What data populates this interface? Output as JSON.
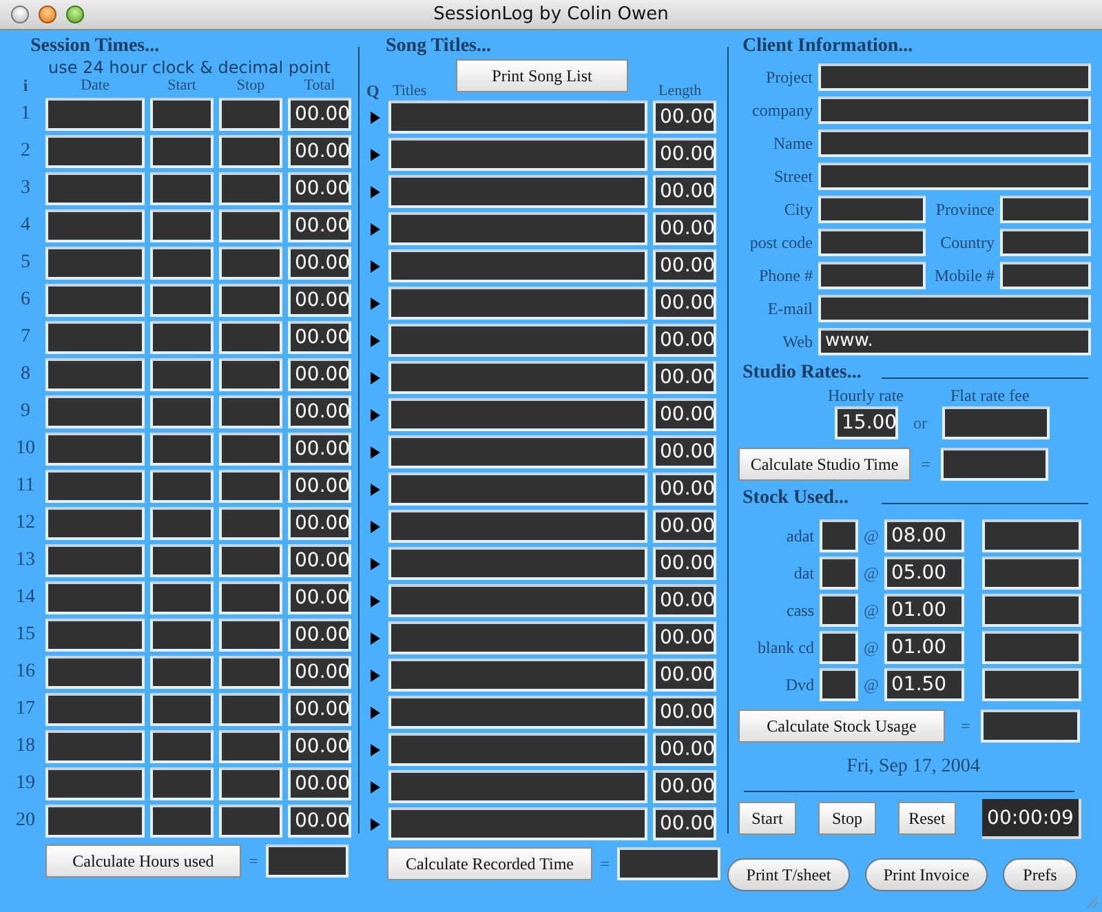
{
  "window": {
    "title": "SessionLog by Colin Owen"
  },
  "session": {
    "heading": "Session Times...",
    "note": "use 24 hour clock &  decimal point",
    "columns": [
      "i",
      "Date",
      "Start",
      "Stop",
      "Total"
    ],
    "rows": [
      {
        "number": "1",
        "total": "00.00"
      },
      {
        "number": "2",
        "total": "00.00"
      },
      {
        "number": "3",
        "total": "00.00"
      },
      {
        "number": "4",
        "total": "00.00"
      },
      {
        "number": "5",
        "total": "00.00"
      },
      {
        "number": "6",
        "total": "00.00"
      },
      {
        "number": "7",
        "total": "00.00"
      },
      {
        "number": "8",
        "total": "00.00"
      },
      {
        "number": "9",
        "total": "00.00"
      },
      {
        "number": "10",
        "total": "00.00"
      },
      {
        "number": "11",
        "total": "00.00"
      },
      {
        "number": "12",
        "total": "00.00"
      },
      {
        "number": "13",
        "total": "00.00"
      },
      {
        "number": "14",
        "total": "00.00"
      },
      {
        "number": "15",
        "total": "00.00"
      },
      {
        "number": "16",
        "total": "00.00"
      },
      {
        "number": "17",
        "total": "00.00"
      },
      {
        "number": "18",
        "total": "00.00"
      },
      {
        "number": "19",
        "total": "00.00"
      },
      {
        "number": "20",
        "total": "00.00"
      }
    ],
    "button": "Calculate Hours used",
    "equals": "="
  },
  "songs": {
    "heading": "Song Titles...",
    "print_button": "Print Song List",
    "columns": [
      "Q",
      "Titles",
      "Length"
    ],
    "rows": [
      {
        "length": "00.00"
      },
      {
        "length": "00.00"
      },
      {
        "length": "00.00"
      },
      {
        "length": "00.00"
      },
      {
        "length": "00.00"
      },
      {
        "length": "00.00"
      },
      {
        "length": "00.00"
      },
      {
        "length": "00.00"
      },
      {
        "length": "00.00"
      },
      {
        "length": "00.00"
      },
      {
        "length": "00.00"
      },
      {
        "length": "00.00"
      },
      {
        "length": "00.00"
      },
      {
        "length": "00.00"
      },
      {
        "length": "00.00"
      },
      {
        "length": "00.00"
      },
      {
        "length": "00.00"
      },
      {
        "length": "00.00"
      },
      {
        "length": "00.00"
      },
      {
        "length": "00.00"
      }
    ],
    "button": "Calculate Recorded Time",
    "equals": "="
  },
  "client": {
    "heading": "Client Information...",
    "rows": [
      [
        {
          "label": "Project"
        }
      ],
      [
        {
          "label": "company"
        }
      ],
      [
        {
          "label": "Name"
        }
      ],
      [
        {
          "label": "Street"
        }
      ],
      [
        {
          "label": "City"
        },
        {
          "label": "Province"
        }
      ],
      [
        {
          "label": "post code"
        },
        {
          "label": "Country"
        }
      ],
      [
        {
          "label": "Phone #"
        },
        {
          "label": "Mobile #"
        }
      ],
      [
        {
          "label": "E-mail"
        }
      ],
      [
        {
          "label": "Web",
          "value": "www."
        }
      ]
    ]
  },
  "rates": {
    "heading": "Studio Rates...",
    "hourly_label": "Hourly rate",
    "hourly_value": "15.00",
    "or": "or",
    "flat_label": "Flat rate fee",
    "button": "Calculate Studio Time",
    "equals": "="
  },
  "stock": {
    "heading": "Stock Used...",
    "items": [
      {
        "name": "adat",
        "at": "@",
        "price": "08.00"
      },
      {
        "name": "dat",
        "at": "@",
        "price": "05.00"
      },
      {
        "name": "cass",
        "at": "@",
        "price": "01.00"
      },
      {
        "name": "blank cd",
        "at": "@",
        "price": "01.00"
      },
      {
        "name": "Dvd",
        "at": "@",
        "price": "01.50"
      }
    ],
    "button": "Calculate Stock Usage",
    "equals": "="
  },
  "date": "Fri, Sep 17, 2004",
  "timer": {
    "buttons": [
      "Start",
      "Stop",
      "Reset"
    ],
    "display": "00:00:09"
  },
  "footer_buttons": [
    "Print T/sheet",
    "Print Invoice",
    "Prefs"
  ]
}
